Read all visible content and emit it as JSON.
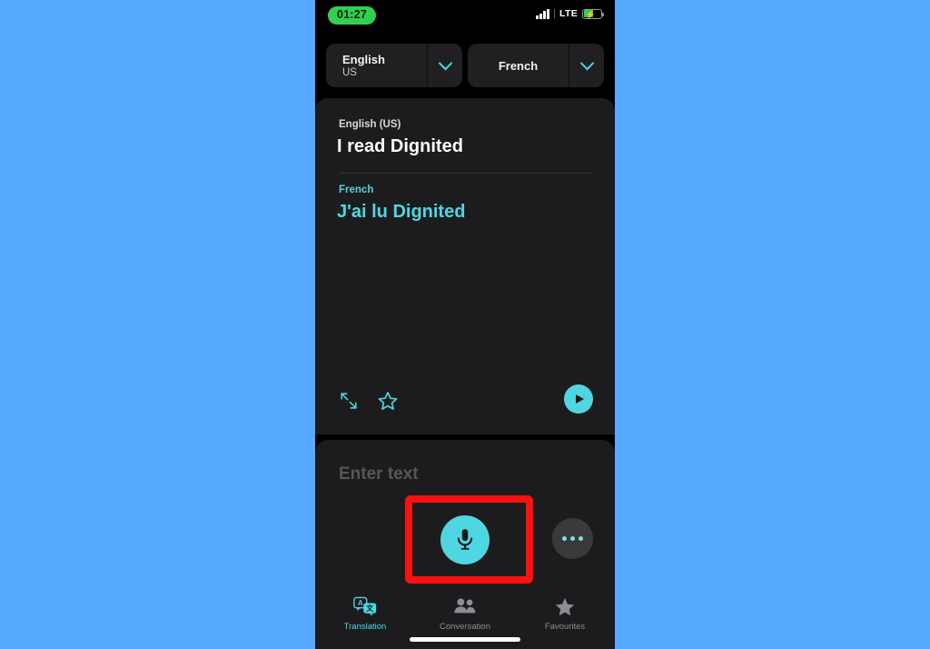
{
  "status_bar": {
    "time": "01:27",
    "network_label": "LTE",
    "signal_icon": "signal-bars-icon",
    "battery_icon": "battery-charging-icon",
    "time_pill_color": "#32d04f",
    "battery_fill_color": "#32d04f"
  },
  "language_selector": {
    "source": {
      "name": "English",
      "region": "US",
      "chevron_icon": "chevron-down-icon"
    },
    "target": {
      "name": "French",
      "region": "",
      "chevron_icon": "chevron-down-icon"
    }
  },
  "translation_card": {
    "source_label": "English (US)",
    "source_text": "I read Dignited",
    "target_label": "French",
    "target_text": "J'ai lu Dignited",
    "accent_color": "#4fd6e0",
    "actions": {
      "expand_icon": "expand-arrows-icon",
      "favourite_icon": "star-outline-icon",
      "play_icon": "play-circle-icon"
    }
  },
  "input_panel": {
    "placeholder": "Enter text",
    "mic_icon": "microphone-icon",
    "more_icon": "more-options-icon"
  },
  "annotation": {
    "highlight_color": "#ff1010",
    "target": "microphone-button"
  },
  "tab_bar": {
    "tabs": [
      {
        "label": "Translation",
        "icon": "translation-bubbles-icon",
        "active": true
      },
      {
        "label": "Conversation",
        "icon": "people-icon",
        "active": false
      },
      {
        "label": "Favourites",
        "icon": "star-filled-icon",
        "active": false
      }
    ]
  }
}
